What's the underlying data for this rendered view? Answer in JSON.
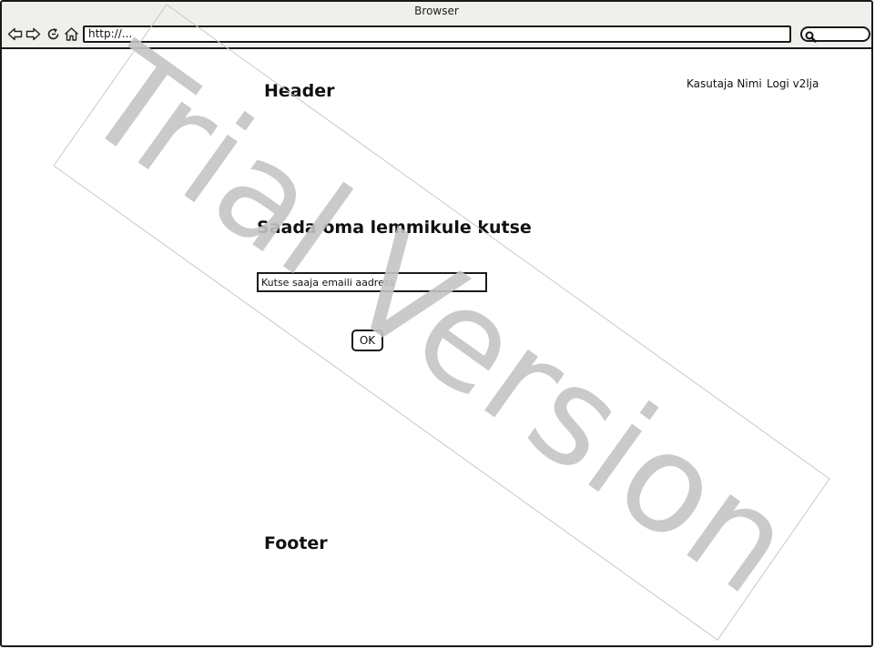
{
  "window": {
    "title": "Browser"
  },
  "toolbar": {
    "back_icon": "arrow-left-icon",
    "forward_icon": "arrow-right-icon",
    "reload_icon": "reload-icon",
    "home_icon": "home-icon",
    "url": "http://...",
    "search_icon": "search-icon"
  },
  "header": {
    "title": "Header",
    "username": "Kasutaja Nimi",
    "logout": "Logi v2lja"
  },
  "main": {
    "title": "Saada oma lemmikule kutse",
    "email_placeholder": "Kutse saaja emaili aadress",
    "ok_label": "OK"
  },
  "footer": {
    "title": "Footer"
  },
  "watermark": {
    "text": "Trial Version"
  }
}
